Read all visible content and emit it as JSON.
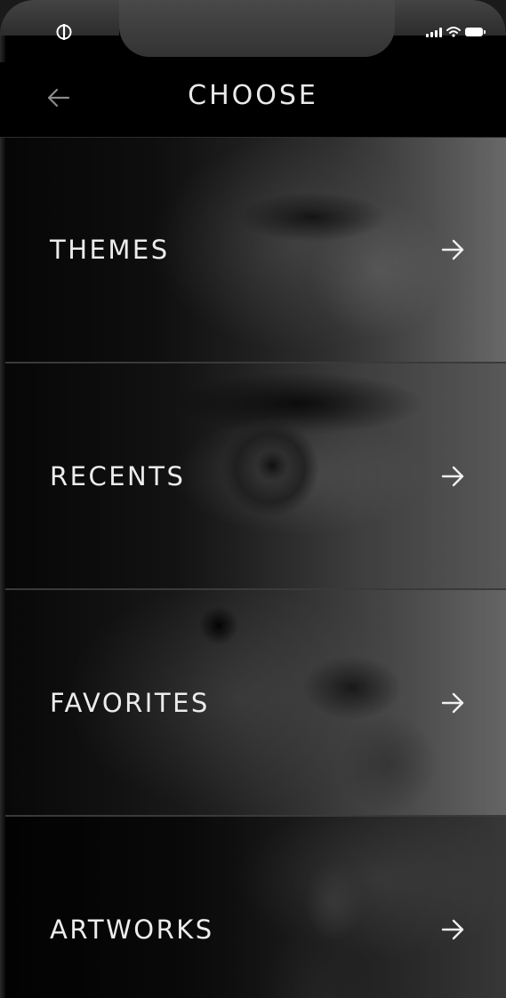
{
  "header": {
    "title": "CHOOSE",
    "back_icon": "arrow-left-icon"
  },
  "status_bar": {
    "left_icon": "app-logo-icon",
    "right_icons": [
      "signal-icon",
      "wifi-icon",
      "battery-icon"
    ]
  },
  "menu": {
    "items": [
      {
        "label": "THEMES",
        "icon": "arrow-right-icon"
      },
      {
        "label": "RECENTS",
        "icon": "arrow-right-icon"
      },
      {
        "label": "FAVORITES",
        "icon": "arrow-right-icon"
      },
      {
        "label": "ARTWORKS",
        "icon": "arrow-right-icon"
      }
    ]
  },
  "colors": {
    "background": "#000000",
    "text": "#ececec",
    "divider": "#3a3a3a",
    "notch": "#3a3a3a"
  }
}
